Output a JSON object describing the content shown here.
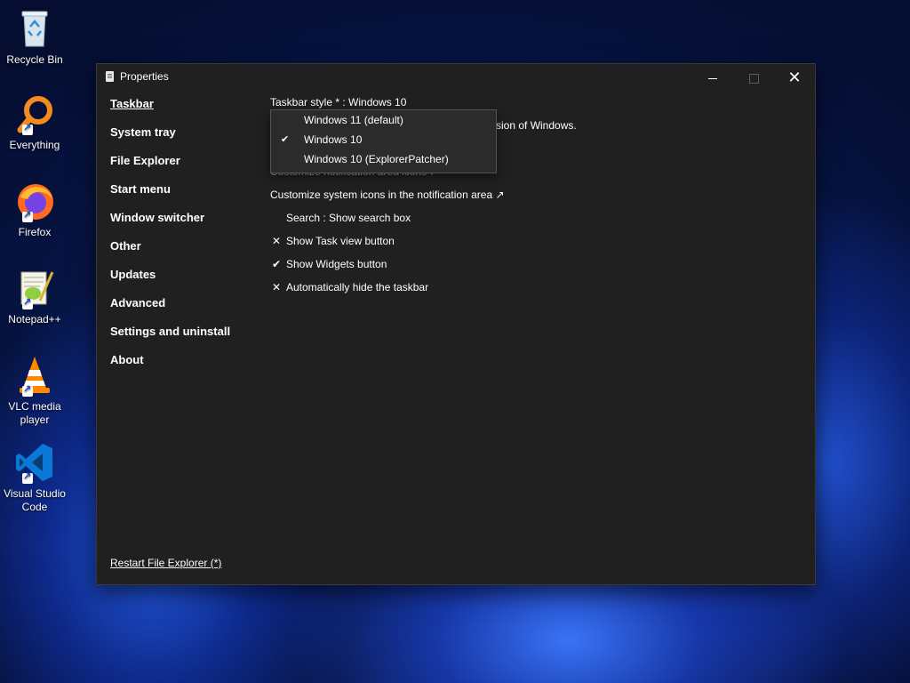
{
  "desktop": {
    "icons": [
      {
        "label": "Recycle Bin",
        "icon": "recycle-bin-icon"
      },
      {
        "label": "Everything",
        "icon": "everything-search-icon"
      },
      {
        "label": "Firefox",
        "icon": "firefox-icon"
      },
      {
        "label": "Notepad++",
        "icon": "notepadpp-icon"
      },
      {
        "label": "VLC media player",
        "icon": "vlc-icon"
      },
      {
        "label": "Visual Studio Code",
        "icon": "vscode-icon"
      }
    ]
  },
  "window": {
    "title": "Properties",
    "buttons": {
      "minimize": "minimize-icon",
      "maximize": "maximize-icon",
      "close": "✕"
    }
  },
  "sidebar": {
    "items": [
      {
        "label": "Taskbar",
        "active": true
      },
      {
        "label": "System tray"
      },
      {
        "label": "File Explorer"
      },
      {
        "label": "Start menu"
      },
      {
        "label": "Window switcher"
      },
      {
        "label": "Other"
      },
      {
        "label": "Updates"
      },
      {
        "label": "Advanced"
      },
      {
        "label": "Settings and uninstall"
      },
      {
        "label": "About"
      }
    ],
    "restart_link": "Restart File Explorer (*)"
  },
  "main": {
    "taskbar_style": "Taskbar style * : Windows 10",
    "partial_description": "sion of Windows.",
    "hidden_link": "Customize notification area icons ↗",
    "system_icons_link": "Customize system icons in the notification area ↗",
    "search": "Search : Show search box",
    "task_view": {
      "mark": "✕",
      "label": "Show Task view button"
    },
    "widgets": {
      "mark": "✔",
      "label": "Show Widgets button"
    },
    "autohide": {
      "mark": "✕",
      "label": "Automatically hide the taskbar"
    }
  },
  "dropdown": {
    "options": [
      {
        "label": "Windows 11 (default)",
        "checked": false
      },
      {
        "label": "Windows 10",
        "checked": true
      },
      {
        "label": "Windows 10 (ExplorerPatcher)",
        "checked": false
      }
    ],
    "check_glyph": "✔"
  },
  "colors": {
    "window_bg": "#202020",
    "dropdown_bg": "#2b2b2b",
    "text": "#ffffff",
    "desktop_accent": "#1e5af0"
  }
}
